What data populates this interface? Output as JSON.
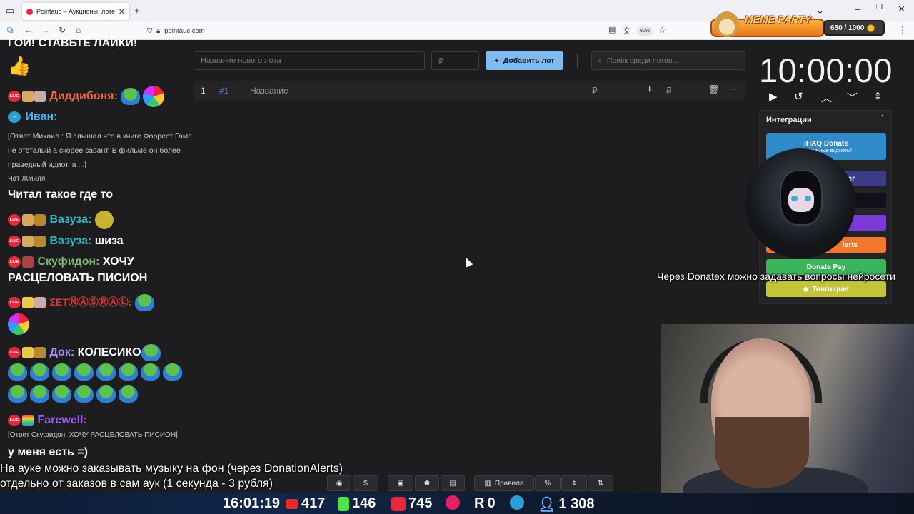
{
  "browser": {
    "tab_title": "Pointauc – Аукционы, лотереи",
    "url": "pointauc.com",
    "zoom": "90%"
  },
  "meme_overlay": {
    "brand": "MEME-PARTY",
    "counter": "650 / 1000"
  },
  "toolbar": {
    "new_lot_placeholder": "Название нового лота",
    "amount_placeholder": "₽",
    "add_lot_label": "Добавить лот",
    "search_placeholder": "Поиск среди лотов..."
  },
  "lot": {
    "index": "1",
    "id": "#1",
    "name_placeholder": "Название",
    "currency": "₽",
    "add_currency": "₽"
  },
  "timer": {
    "value": "10:00:00"
  },
  "integrations": {
    "title": "Интеграции",
    "items": [
      {
        "label": "IHAQ Donate",
        "sub": "Уникальные виджеты!",
        "color": "#2f8ac9"
      },
      {
        "label": "er",
        "color": "#3b3b8a"
      },
      {
        "label": "",
        "color": "#120f1a"
      },
      {
        "label": "",
        "color": "#7a3ad6"
      },
      {
        "label": "lerts",
        "color": "#f2772a"
      },
      {
        "label": "Donate Pay",
        "color": "#3ab55a"
      },
      {
        "label": "Tourniquet",
        "color": "#c3c43a"
      }
    ]
  },
  "chat": {
    "top_line": "ГОЙ! СТАВЬТЕ ЛАЙКИ!",
    "messages": [
      {
        "user": "Диддибоня:",
        "color": "#f0693b",
        "text": ""
      },
      {
        "user": "Иван:",
        "color": "#4ab1ef",
        "text": ""
      },
      {
        "reply": "[Ответ Михаил : Я слышал что в книге Форрест Гамп не отсталый а скорее савант. В фильме он более праведный идиот, а ...]"
      },
      {
        "source": "Чат Жмиля"
      },
      {
        "text": "Читал такое где то"
      },
      {
        "user": "Вазуза:",
        "color": "#2fb5c8",
        "text": ""
      },
      {
        "user": "Вазуза:",
        "color": "#2fb5c8",
        "text": "шиза"
      },
      {
        "user": "Скуфидон:",
        "color": "#82b56a",
        "text": "ХОЧУ"
      },
      {
        "text": "РАСЦЕЛОВАТЬ ПИСИОН"
      },
      {
        "user": "ΣΕΤⓃⒶⓈⓇⒶⓁ:",
        "color": "#d83b3b",
        "text": ""
      },
      {
        "user": "Док:",
        "color": "#a28ff3",
        "text": "КОЛЕСИКО"
      },
      {
        "user": "Farewell:",
        "color": "#9a5cf2",
        "text": ""
      },
      {
        "reply": "[Ответ Скуфидон: ХОЧУ РАСЦЕЛОВАТЬ ПИСИОН]"
      },
      {
        "text": "у меня есть =)"
      }
    ]
  },
  "overlay": {
    "donatex": "Через Donatex можно задавать вопросы нейросети",
    "music_line1": "На ауке можно заказывать музыку на фон (через DonationAlerts)",
    "music_line2": "отдельно от заказов в сам аук (1 секунда - 3 рубля)"
  },
  "bottom_toolbar": {
    "rules_label": "Правила",
    "percent_label": "%"
  },
  "stream_bar": {
    "time": "16:01:19",
    "youtube": "417",
    "kick": "146",
    "vk": "745",
    "rutube": "0",
    "viewers": "1 308"
  }
}
